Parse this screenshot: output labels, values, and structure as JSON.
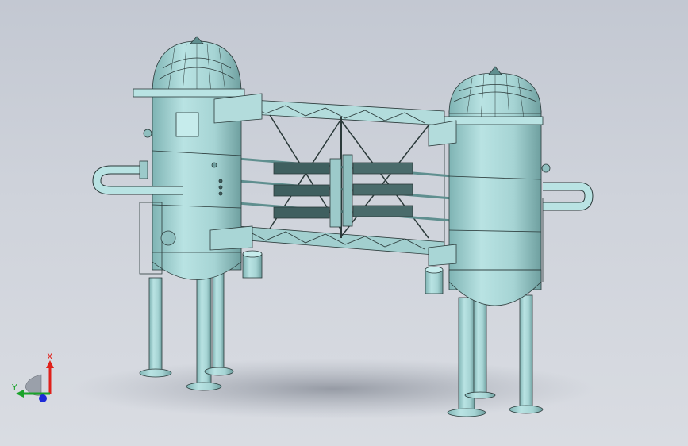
{
  "viewport": {
    "background_top": "#c3c8d2",
    "background_bottom": "#d9dce2"
  },
  "model": {
    "body_color": "#a8d6d6",
    "edge_color": "#2b3a3a",
    "shadow_color": "#9ea3ad"
  },
  "triad": {
    "x_label": "X",
    "y_label": "Y",
    "x_color": "#e0201a",
    "y_color": "#1aa32a",
    "z_color": "#1c2ad8"
  }
}
